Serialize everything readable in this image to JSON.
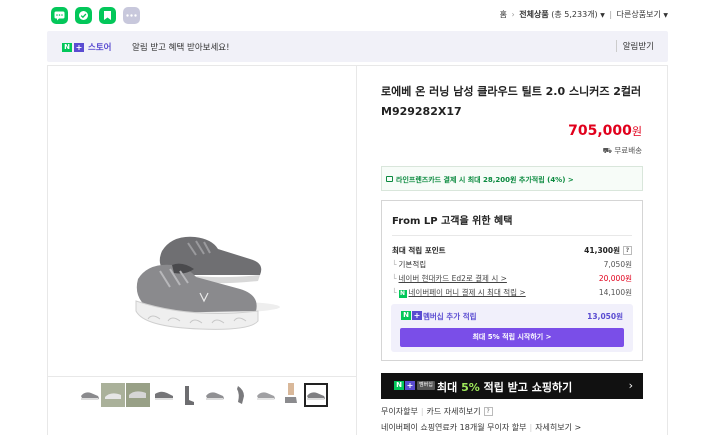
{
  "topbar": {
    "icons": [
      {
        "name": "talk-icon",
        "color": "#03c75a",
        "glyph": "💬"
      },
      {
        "name": "store-favorite-icon",
        "color": "#03c75a",
        "glyph": "✓"
      },
      {
        "name": "bookmark-icon",
        "color": "#03c75a",
        "glyph": "⚑"
      },
      {
        "name": "more-icon",
        "color": "#c8c8dc",
        "glyph": "···"
      }
    ],
    "breadcrumb_home": "홈",
    "breadcrumb_all": "전체상품",
    "breadcrumb_count": "(총 5,233개)",
    "other_shops": "다른상품보기"
  },
  "store_banner": {
    "logo_n": "N",
    "logo_plus": "+",
    "logo_text": "스토어",
    "message": "알림 받고 혜택 받아보세요!",
    "action": "알림받기"
  },
  "product": {
    "title": "로에베 온 러닝 남성 클라우드 틸트 2.0 스니커즈 2컬러 M929282X17",
    "price": "705,000",
    "price_unit": "원",
    "shipping": "무료배송",
    "thumbnail_count": 10
  },
  "card_banner": {
    "text": "라인프렌즈카드 결제 시 최대 28,200원 추가적립 (4%) >"
  },
  "benefit": {
    "title": "From LP 고객을 위한 혜택",
    "max_points_label": "최대 적립 포인트",
    "max_points_value": "41,300원",
    "help_mark": "?",
    "rows": [
      {
        "label": "기본적립",
        "value": "7,050원"
      },
      {
        "label": "네이버 현대카드 Ed2로 결제 시 >",
        "value": "20,000원"
      },
      {
        "label": "네이버페이 머니 결제 시 최대 적립 >",
        "value": "14,100원"
      }
    ],
    "membership_label": "멤버십 추가 적립",
    "membership_value": "13,050원",
    "membership_button": "최대 5% 적립 시작하기 >"
  },
  "black_banner": {
    "member_tag": "멤버십",
    "text_prefix": "최대 ",
    "text_highlight": "5%",
    "text_suffix": " 적립 받고 쇼핑하기",
    "arrow": "›"
  },
  "installments": {
    "line1_a": "무이자할부",
    "line1_b": "카드 자세히보기",
    "line2_a": "네이버페이 쇼핑연료카 18개월 무이자 할부",
    "line2_b": "자세히보기 >"
  },
  "colors": {
    "price": "#e1001c",
    "naver_green": "#03c75a",
    "store_purple": "#5a4cd1",
    "membership_button": "#7a4ee8"
  }
}
